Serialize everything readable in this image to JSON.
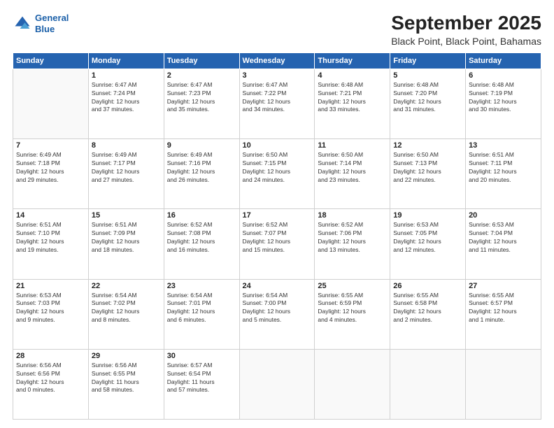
{
  "header": {
    "logo_line1": "General",
    "logo_line2": "Blue",
    "title": "September 2025",
    "subtitle": "Black Point, Black Point, Bahamas"
  },
  "weekdays": [
    "Sunday",
    "Monday",
    "Tuesday",
    "Wednesday",
    "Thursday",
    "Friday",
    "Saturday"
  ],
  "weeks": [
    [
      {
        "day": "",
        "info": ""
      },
      {
        "day": "1",
        "info": "Sunrise: 6:47 AM\nSunset: 7:24 PM\nDaylight: 12 hours\nand 37 minutes."
      },
      {
        "day": "2",
        "info": "Sunrise: 6:47 AM\nSunset: 7:23 PM\nDaylight: 12 hours\nand 35 minutes."
      },
      {
        "day": "3",
        "info": "Sunrise: 6:47 AM\nSunset: 7:22 PM\nDaylight: 12 hours\nand 34 minutes."
      },
      {
        "day": "4",
        "info": "Sunrise: 6:48 AM\nSunset: 7:21 PM\nDaylight: 12 hours\nand 33 minutes."
      },
      {
        "day": "5",
        "info": "Sunrise: 6:48 AM\nSunset: 7:20 PM\nDaylight: 12 hours\nand 31 minutes."
      },
      {
        "day": "6",
        "info": "Sunrise: 6:48 AM\nSunset: 7:19 PM\nDaylight: 12 hours\nand 30 minutes."
      }
    ],
    [
      {
        "day": "7",
        "info": "Sunrise: 6:49 AM\nSunset: 7:18 PM\nDaylight: 12 hours\nand 29 minutes."
      },
      {
        "day": "8",
        "info": "Sunrise: 6:49 AM\nSunset: 7:17 PM\nDaylight: 12 hours\nand 27 minutes."
      },
      {
        "day": "9",
        "info": "Sunrise: 6:49 AM\nSunset: 7:16 PM\nDaylight: 12 hours\nand 26 minutes."
      },
      {
        "day": "10",
        "info": "Sunrise: 6:50 AM\nSunset: 7:15 PM\nDaylight: 12 hours\nand 24 minutes."
      },
      {
        "day": "11",
        "info": "Sunrise: 6:50 AM\nSunset: 7:14 PM\nDaylight: 12 hours\nand 23 minutes."
      },
      {
        "day": "12",
        "info": "Sunrise: 6:50 AM\nSunset: 7:13 PM\nDaylight: 12 hours\nand 22 minutes."
      },
      {
        "day": "13",
        "info": "Sunrise: 6:51 AM\nSunset: 7:11 PM\nDaylight: 12 hours\nand 20 minutes."
      }
    ],
    [
      {
        "day": "14",
        "info": "Sunrise: 6:51 AM\nSunset: 7:10 PM\nDaylight: 12 hours\nand 19 minutes."
      },
      {
        "day": "15",
        "info": "Sunrise: 6:51 AM\nSunset: 7:09 PM\nDaylight: 12 hours\nand 18 minutes."
      },
      {
        "day": "16",
        "info": "Sunrise: 6:52 AM\nSunset: 7:08 PM\nDaylight: 12 hours\nand 16 minutes."
      },
      {
        "day": "17",
        "info": "Sunrise: 6:52 AM\nSunset: 7:07 PM\nDaylight: 12 hours\nand 15 minutes."
      },
      {
        "day": "18",
        "info": "Sunrise: 6:52 AM\nSunset: 7:06 PM\nDaylight: 12 hours\nand 13 minutes."
      },
      {
        "day": "19",
        "info": "Sunrise: 6:53 AM\nSunset: 7:05 PM\nDaylight: 12 hours\nand 12 minutes."
      },
      {
        "day": "20",
        "info": "Sunrise: 6:53 AM\nSunset: 7:04 PM\nDaylight: 12 hours\nand 11 minutes."
      }
    ],
    [
      {
        "day": "21",
        "info": "Sunrise: 6:53 AM\nSunset: 7:03 PM\nDaylight: 12 hours\nand 9 minutes."
      },
      {
        "day": "22",
        "info": "Sunrise: 6:54 AM\nSunset: 7:02 PM\nDaylight: 12 hours\nand 8 minutes."
      },
      {
        "day": "23",
        "info": "Sunrise: 6:54 AM\nSunset: 7:01 PM\nDaylight: 12 hours\nand 6 minutes."
      },
      {
        "day": "24",
        "info": "Sunrise: 6:54 AM\nSunset: 7:00 PM\nDaylight: 12 hours\nand 5 minutes."
      },
      {
        "day": "25",
        "info": "Sunrise: 6:55 AM\nSunset: 6:59 PM\nDaylight: 12 hours\nand 4 minutes."
      },
      {
        "day": "26",
        "info": "Sunrise: 6:55 AM\nSunset: 6:58 PM\nDaylight: 12 hours\nand 2 minutes."
      },
      {
        "day": "27",
        "info": "Sunrise: 6:55 AM\nSunset: 6:57 PM\nDaylight: 12 hours\nand 1 minute."
      }
    ],
    [
      {
        "day": "28",
        "info": "Sunrise: 6:56 AM\nSunset: 6:56 PM\nDaylight: 12 hours\nand 0 minutes."
      },
      {
        "day": "29",
        "info": "Sunrise: 6:56 AM\nSunset: 6:55 PM\nDaylight: 11 hours\nand 58 minutes."
      },
      {
        "day": "30",
        "info": "Sunrise: 6:57 AM\nSunset: 6:54 PM\nDaylight: 11 hours\nand 57 minutes."
      },
      {
        "day": "",
        "info": ""
      },
      {
        "day": "",
        "info": ""
      },
      {
        "day": "",
        "info": ""
      },
      {
        "day": "",
        "info": ""
      }
    ]
  ]
}
